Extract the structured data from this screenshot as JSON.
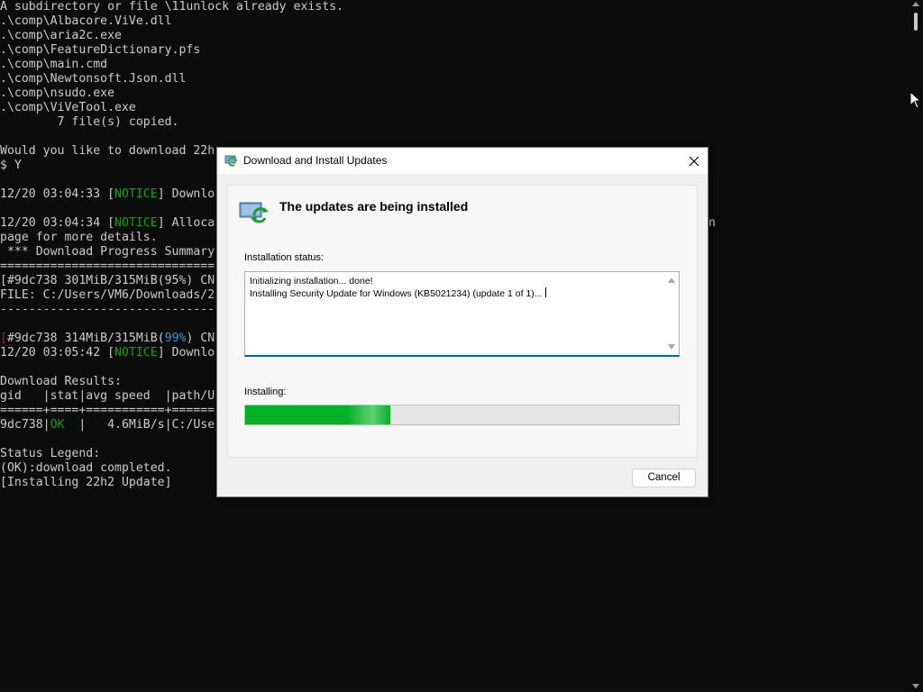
{
  "console": {
    "lines": [
      [
        {
          "t": "A subdirectory or file \\11unlock already exists."
        }
      ],
      [
        {
          "t": ".\\comp\\Albacore.ViVe.dll"
        }
      ],
      [
        {
          "t": ".\\comp\\aria2c.exe"
        }
      ],
      [
        {
          "t": ".\\comp\\FeatureDictionary.pfs"
        }
      ],
      [
        {
          "t": ".\\comp\\main.cmd"
        }
      ],
      [
        {
          "t": ".\\comp\\Newtonsoft.Json.dll"
        }
      ],
      [
        {
          "t": ".\\comp\\nsudo.exe"
        }
      ],
      [
        {
          "t": ".\\comp\\ViVeTool.exe"
        }
      ],
      [
        {
          "t": "        7 file(s) copied."
        }
      ],
      [
        {
          "t": ""
        }
      ],
      [
        {
          "t": "Would you like to download 22h"
        }
      ],
      [
        {
          "t": "$ Y"
        }
      ],
      [
        {
          "t": ""
        }
      ],
      [
        {
          "t": "12/20 03:04:33 ["
        },
        {
          "t": "NOTICE",
          "c": "g"
        },
        {
          "t": "] Downlo"
        }
      ],
      [
        {
          "t": ""
        }
      ],
      [
        {
          "t": "12/20 03:04:34 ["
        },
        {
          "t": "NOTICE",
          "c": "g"
        },
        {
          "t": "] Alloca"
        },
        {
          "t": "                                            "
        },
        {
          "t": "e-allocation option in man"
        }
      ],
      [
        {
          "t": "page for more details."
        }
      ],
      [
        {
          "t": " *** Download Progress Summary"
        }
      ],
      [
        {
          "t": "==============================                                 ============================"
        }
      ],
      [
        {
          "t": "[#9dc738 301MiB/315MiB(95%) CN"
        }
      ],
      [
        {
          "t": "FILE: C:/Users/VM6/Downloads/2"
        }
      ],
      [
        {
          "t": "------------------------------                                 ----------------------------"
        }
      ],
      [
        {
          "t": ""
        }
      ],
      [
        {
          "t": "[",
          "c": "r"
        },
        {
          "t": "#9dc738 314MiB/315MiB("
        },
        {
          "t": "99%",
          "c": "c"
        },
        {
          "t": ") CN"
        }
      ],
      [
        {
          "t": "12/20 03:05:42 ["
        },
        {
          "t": "NOTICE",
          "c": "g"
        },
        {
          "t": "] Downlo"
        }
      ],
      [
        {
          "t": ""
        }
      ],
      [
        {
          "t": "Download Results:"
        }
      ],
      [
        {
          "t": "gid   |stat|avg speed  |path/U"
        }
      ],
      [
        {
          "t": "======+====+===========+======"
        }
      ],
      [
        {
          "t": "9dc738|"
        },
        {
          "t": "OK",
          "c": "g"
        },
        {
          "t": "  |   4.6MiB/s|C:/Use"
        }
      ],
      [
        {
          "t": ""
        }
      ],
      [
        {
          "t": "Status Legend:"
        }
      ],
      [
        {
          "t": "(OK):download completed."
        }
      ],
      [
        {
          "t": "[Installing 22h2 Update]"
        }
      ]
    ]
  },
  "dialog": {
    "title": "Download and Install Updates",
    "close_icon": "close-icon",
    "heading": "The updates are being installed",
    "status_label": "Installation status:",
    "status_lines": [
      "Initializing installation... done!",
      "Installing Security Update for Windows (KB5021234) (update 1 of 1)..."
    ],
    "installing_label": "Installing:",
    "progress_fraction": 0.335,
    "cancel_label": "Cancel"
  },
  "colors": {
    "console_bg": "#0c0c0c",
    "console_text": "#cccccc",
    "notice_green": "#13a10e",
    "percent_cyan": "#3a96dd",
    "progress_green": "#06b025",
    "focus_blue": "#0067c0"
  }
}
